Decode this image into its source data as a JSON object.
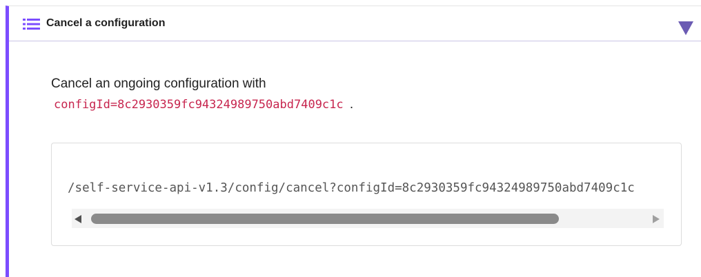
{
  "section": {
    "title": "Cancel a configuration",
    "icon": "list-numbered-icon",
    "toggle_icon": "triangle-down-icon",
    "accent_color": "#7c4dff"
  },
  "description": {
    "text": "Cancel an ongoing configuration with",
    "code": "configId=8c2930359fc94324989750abd7409c1c",
    "trailing": "."
  },
  "code_block": {
    "text": "/self-service-api-v1.3/config/cancel?configId=8c2930359fc94324989750abd7409c1c"
  }
}
